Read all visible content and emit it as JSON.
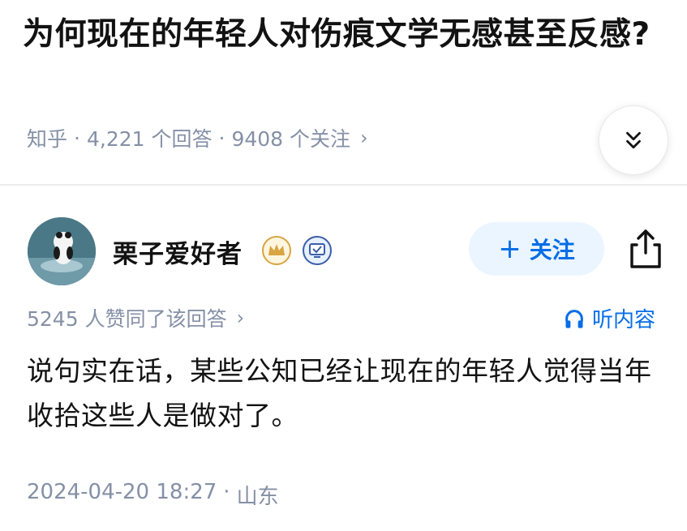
{
  "question": {
    "title": "为何现在的年轻人对伤痕文学无感甚至反感?",
    "source": "知乎",
    "answers": "4,221 个回答",
    "followers": "9408 个关注",
    "separator": "·",
    "chevron": "›",
    "expand_icon": "double-chevron-down-icon"
  },
  "author": {
    "name": "栗子爱好者",
    "badges": [
      "crown-badge-icon",
      "verified-badge-icon"
    ],
    "follow_plus": "+",
    "follow_label": "关注",
    "share_icon": "share-icon"
  },
  "answer": {
    "votes": "5245 人赞同了该回答",
    "vote_chevron": "›",
    "listen_label": "听内容",
    "body": "说句实在话，某些公知已经让现在的年轻人觉得当年收拾这些人是做对了。",
    "date": "2024-04-20 18:27",
    "location": "山东",
    "footer_separator": "·"
  },
  "colors": {
    "accent": "#056de8",
    "accent_bg": "#ebf5ff",
    "meta_text": "#8590a6",
    "badge_gold": "#d9a441"
  }
}
